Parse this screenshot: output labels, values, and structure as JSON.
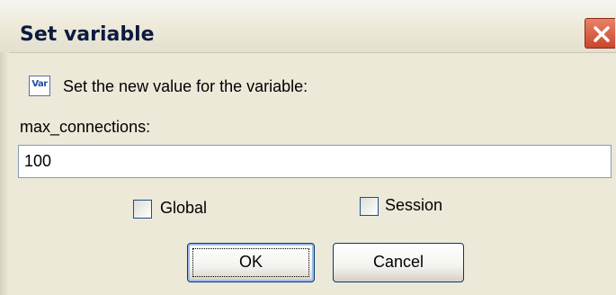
{
  "window": {
    "title": "Set variable"
  },
  "body": {
    "icon": "var-icon",
    "icon_text": "Var",
    "intro": "Set the new value for the variable:",
    "variable_name": "max_connections:",
    "value": "100"
  },
  "options": {
    "global_label": "Global",
    "global_checked": false,
    "session_label": "Session",
    "session_checked": false
  },
  "buttons": {
    "ok": "OK",
    "cancel": "Cancel"
  },
  "colors": {
    "close_button": "#d8573a",
    "background": "#ece9d8",
    "button_border": "#003c74"
  }
}
